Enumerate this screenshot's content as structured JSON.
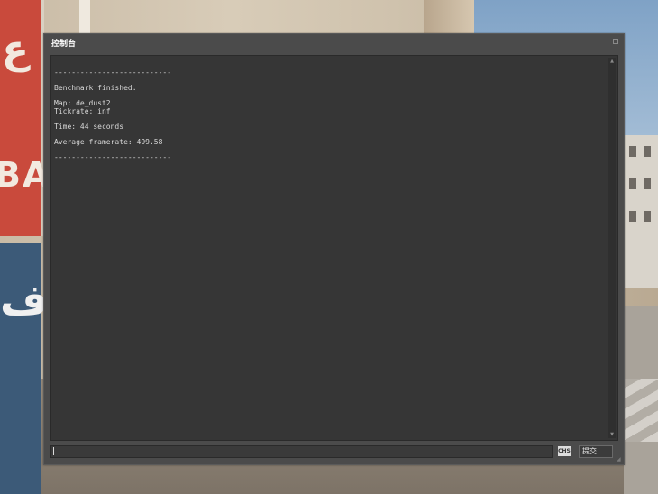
{
  "window": {
    "title": "控制台"
  },
  "console_output": {
    "lines": [
      "---------------------------",
      "",
      "Benchmark finished.",
      "",
      "Map: de_dust2",
      "Tickrate: inf",
      "",
      "Time: 44 seconds",
      "",
      "Average framerate: 499.58",
      "",
      "---------------------------"
    ]
  },
  "input": {
    "value": "",
    "ime_indicator": "CHS"
  },
  "buttons": {
    "submit_label": "提交"
  },
  "icons": {
    "close": "close-icon",
    "scroll_up": "scroll-up-arrow-icon",
    "scroll_down": "scroll-down-arrow-icon",
    "resize": "resize-grip-icon"
  },
  "background": {
    "sign_red_text": "BA"
  }
}
